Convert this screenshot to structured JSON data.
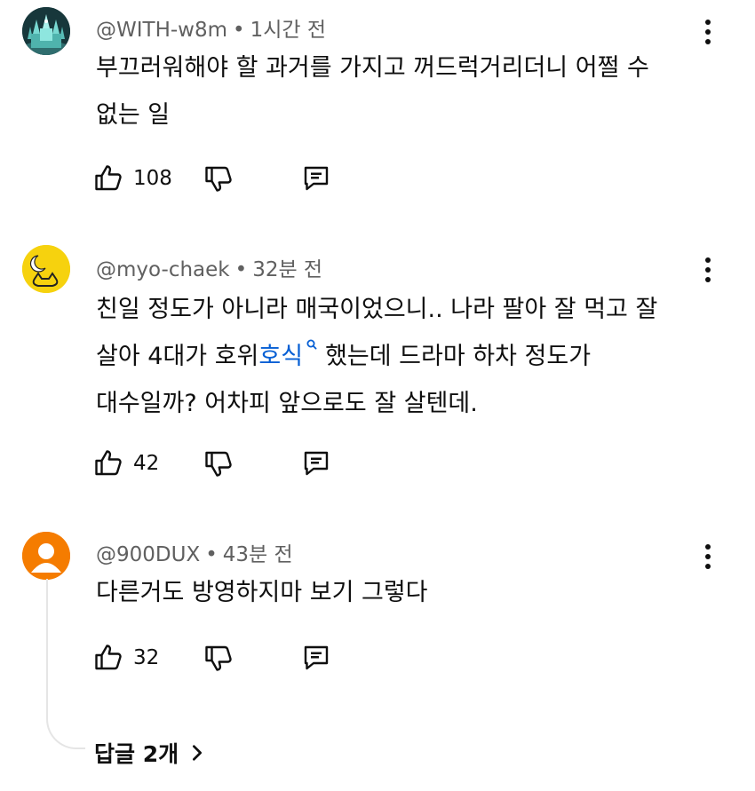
{
  "comments": [
    {
      "author": "@WITH-w8m",
      "time": "1시간 전",
      "text_lines": [
        "부끄러워해야 할 과거를 가지고 꺼드럭거리더니 어쩔 수",
        "없는 일"
      ],
      "likes": "108",
      "avatar_icon": "ice-castle-avatar"
    },
    {
      "author": "@myo-chaek",
      "time": "32분 전",
      "line1": "친일 정도가 아니라 매국이었으니.. 나라 팔아 잘 먹고 잘",
      "line2_before": "살아 4대가 호위",
      "line2_link": "호식",
      "line2_after": "했는데 드라마 하차 정도가",
      "line3": "대수일까? 어차피 앞으로도 잘 살텐데.",
      "likes": "42",
      "avatar_icon": "moon-cat-avatar"
    },
    {
      "author": "@900DUX",
      "time": "43분 전",
      "text_lines": [
        "다른거도 방영하지마 보기 그렇다"
      ],
      "likes": "32",
      "avatar_icon": "default-person-avatar"
    }
  ],
  "meta_separator": "•",
  "replies_label": "답글 2개",
  "colors": {
    "text": "#0f0f0f",
    "meta": "#606060",
    "link": "#065fd4",
    "avatar_orange": "#f57c00",
    "avatar_yellow": "#f6d20e",
    "avatar_teal": "#1f4a4f",
    "thread_line": "#e5e5e5"
  },
  "icons": [
    "thumbs-up-icon",
    "thumbs-down-icon",
    "reply-icon",
    "more-vert-icon",
    "search-icon",
    "chevron-right-icon"
  ]
}
